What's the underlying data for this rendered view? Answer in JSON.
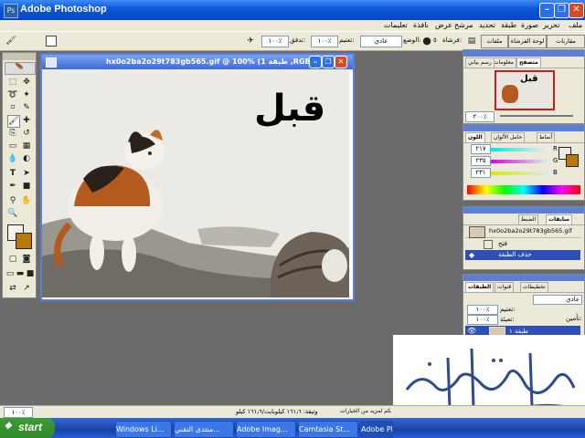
{
  "window": {
    "title": "Adobe Photoshop",
    "app_icon": "Ps"
  },
  "menu": {
    "items": [
      "ملف",
      "تحرير",
      "صورة",
      "طبقة",
      "تحديد",
      "مرشح",
      "عرض",
      "نافذة",
      "تعليمات"
    ]
  },
  "options": {
    "flow_label": "تدفق:",
    "flow_value": "١٠٠٪",
    "opacity_label": "تعتيم:",
    "opacity_value": "١٠٠٪",
    "mode_label": "الوضع:",
    "mode_value": "عادي",
    "brush_label": "فرشاة:",
    "brush_size": "٥",
    "tabs": [
      "ملفات",
      "لوحة الفرشاة",
      "مقارنات الطبقة"
    ]
  },
  "document": {
    "title": "hx0o2ba2o29t783gb565.gif @ 100% (طبقة 1 ,RGB/8)",
    "caption": "قبل"
  },
  "navigator": {
    "tabs": [
      "متصفح",
      "معلومات",
      "رسم بياني"
    ],
    "zoom_value": "٢٠٠٪",
    "thumb_caption": "قبل"
  },
  "color": {
    "tabs": [
      "اللون",
      "حامل الألوان",
      "أنماط"
    ],
    "r_label": "R",
    "r_value": "٢١٧",
    "g_label": "G",
    "g_value": "٢٣٥",
    "b_label": "B",
    "b_value": "٢٣١"
  },
  "history": {
    "tabs": [
      "سابقات",
      "الضبط"
    ],
    "filename": "hx0o2ba2o29t783gb565.gif",
    "items": [
      "فتح",
      "حذف الطبقة"
    ]
  },
  "layers": {
    "tabs": [
      "الطبقات",
      "قنوات",
      "تخطيطات"
    ],
    "blend_mode": "عادي",
    "opacity_label": "تعتيم:",
    "opacity_value": "١٠٠٪",
    "fill_label": "تعبئة:",
    "fill_value": "١٠٠٪",
    "lock_label": "تأمين:",
    "layer_name": "طبقة ١"
  },
  "status": {
    "zoom": "١٠٠٪",
    "doc_info": "وثيقة: ١٦١٫٦ كيلوبايت/١٦١٫٦ كيلو",
    "hint": "أنقر وأسحب اللون باستخدام لون الواجهة، استخدم مفاتيح الفاعل والاختيار والتحكم لمزيد من الخيارات."
  },
  "taskbar": {
    "start": "start",
    "tasks": [
      "Windows Li...",
      "منتدى التقني...",
      "Adobe Imag...",
      "Camtasia St...",
      "Adobe Pho..."
    ]
  },
  "colors": {
    "accent": "#0a54d8",
    "taskbar": "#245edb",
    "start": "#3c9d33",
    "close": "#d84a23"
  }
}
